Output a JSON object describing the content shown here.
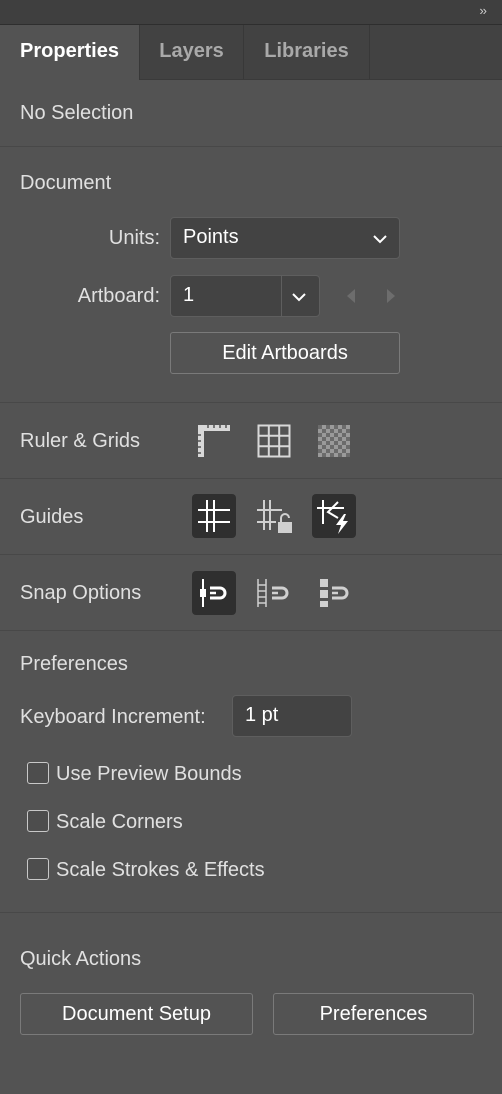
{
  "window": {
    "collapse_glyph": "››"
  },
  "tabs": [
    {
      "label": "Properties",
      "active": true
    },
    {
      "label": "Layers",
      "active": false
    },
    {
      "label": "Libraries",
      "active": false
    }
  ],
  "selection_status": "No Selection",
  "document": {
    "heading": "Document",
    "units_label": "Units:",
    "units_value": "Points",
    "artboard_label": "Artboard:",
    "artboard_value": "1",
    "edit_artboards_label": "Edit Artboards"
  },
  "ruler_grids": {
    "label": "Ruler & Grids",
    "icons": [
      "ruler-icon",
      "grid-icon",
      "transparency-grid-icon"
    ]
  },
  "guides": {
    "label": "Guides",
    "icons": [
      "guides-icon",
      "lock-guides-icon",
      "smart-guides-icon"
    ],
    "active": [
      true,
      false,
      true
    ]
  },
  "snap": {
    "label": "Snap Options",
    "icons": [
      "snap-to-point-icon",
      "snap-to-grid-icon",
      "snap-to-pixel-icon"
    ],
    "active": [
      true,
      false,
      false
    ]
  },
  "preferences": {
    "heading": "Preferences",
    "keyboard_increment_label": "Keyboard Increment:",
    "keyboard_increment_value": "1 pt",
    "checkboxes": [
      {
        "label": "Use Preview Bounds",
        "checked": false
      },
      {
        "label": "Scale Corners",
        "checked": false
      },
      {
        "label": "Scale Strokes & Effects",
        "checked": false
      }
    ]
  },
  "quick_actions": {
    "heading": "Quick Actions",
    "document_setup_label": "Document Setup",
    "preferences_label": "Preferences"
  },
  "colors": {
    "panel_bg": "#535353",
    "tab_bar": "#424242",
    "active_icon_bg": "#2f2f2f"
  }
}
